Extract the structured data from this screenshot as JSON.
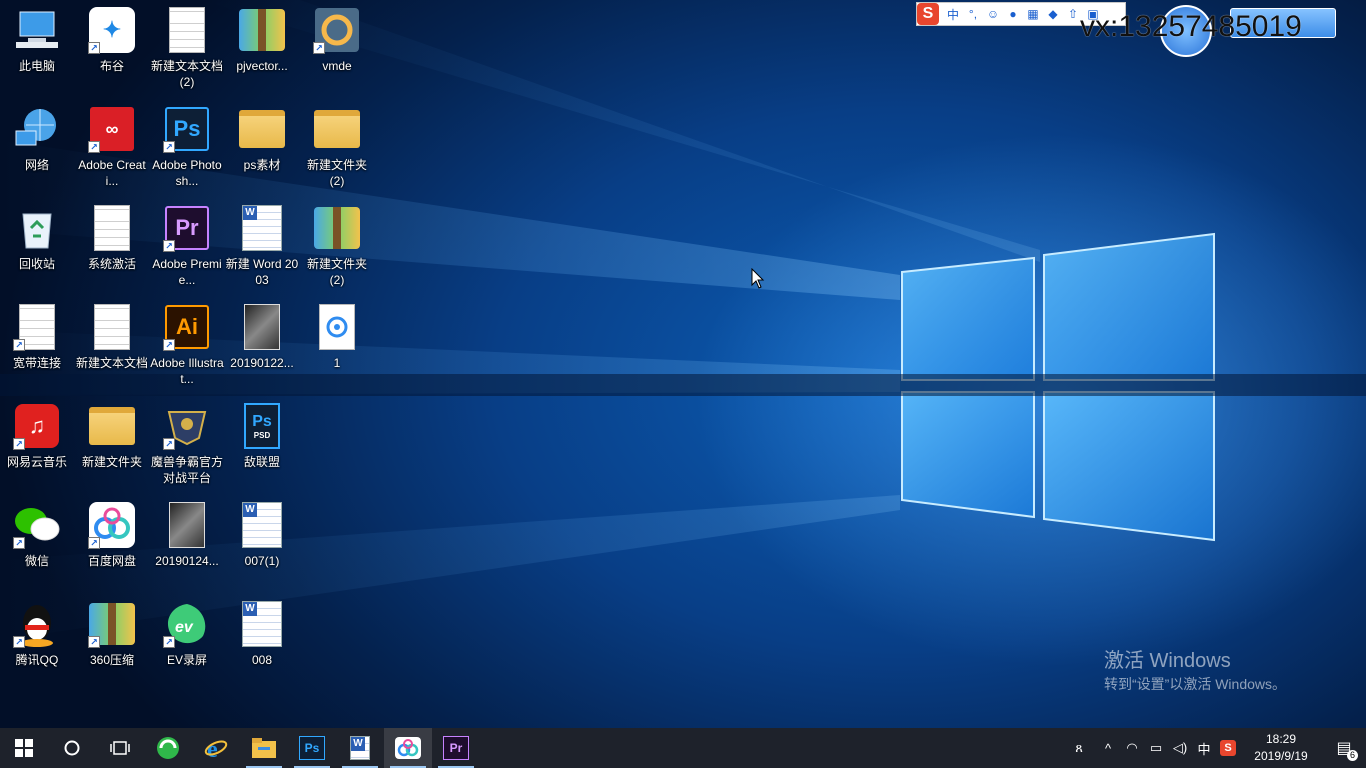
{
  "desktop": {
    "icons": [
      {
        "label": "此电脑",
        "kind": "computer-icon",
        "shortcut": false
      },
      {
        "label": "网络",
        "kind": "network-icon",
        "shortcut": false
      },
      {
        "label": "回收站",
        "kind": "recycle-bin-icon",
        "shortcut": false
      },
      {
        "label": "宽带连接",
        "kind": "file-icon",
        "shortcut": true
      },
      {
        "label": "网易云音乐",
        "kind": "netease-music-icon",
        "shortcut": true
      },
      {
        "label": "微信",
        "kind": "wechat-icon",
        "shortcut": true
      },
      {
        "label": "腾讯QQ",
        "kind": "qq-icon",
        "shortcut": true
      },
      {
        "label": "布谷",
        "kind": "bird-icon",
        "shortcut": true
      },
      {
        "label": "Adobe Creati...",
        "kind": "adobe-cc-icon",
        "shortcut": true
      },
      {
        "label": "系统激活",
        "kind": "file-icon",
        "shortcut": false
      },
      {
        "label": "新建文本文档",
        "kind": "file-icon",
        "shortcut": false
      },
      {
        "label": "新建文件夹",
        "kind": "folder-icon",
        "shortcut": false
      },
      {
        "label": "百度网盘",
        "kind": "baidu-pan-icon",
        "shortcut": true
      },
      {
        "label": "360压缩",
        "kind": "zip-icon",
        "shortcut": true
      },
      {
        "label": "新建文本文档 (2)",
        "kind": "file-icon",
        "shortcut": false
      },
      {
        "label": "Adobe Photosh...",
        "kind": "photoshop-icon",
        "shortcut": true
      },
      {
        "label": "Adobe Premie...",
        "kind": "premiere-icon",
        "shortcut": true
      },
      {
        "label": "Adobe Illustrat...",
        "kind": "illustrator-icon",
        "shortcut": true
      },
      {
        "label": "魔兽争霸官方对战平台",
        "kind": "warcraft-icon",
        "shortcut": true
      },
      {
        "label": "20190124...",
        "kind": "photo-icon",
        "shortcut": false
      },
      {
        "label": "EV录屏",
        "kind": "ev-recorder-icon",
        "shortcut": true
      },
      {
        "label": "pjvector...",
        "kind": "zip-icon",
        "shortcut": false
      },
      {
        "label": "ps素材",
        "kind": "folder-icon",
        "shortcut": false
      },
      {
        "label": "新建 Word 2003",
        "kind": "word-doc-icon",
        "shortcut": false
      },
      {
        "label": "20190122...",
        "kind": "photo-icon",
        "shortcut": false
      },
      {
        "label": "敌联盟",
        "kind": "psd-file-icon",
        "shortcut": false
      },
      {
        "label": "007(1)",
        "kind": "word-doc-icon",
        "shortcut": false
      },
      {
        "label": "008",
        "kind": "word-doc-icon",
        "shortcut": false
      },
      {
        "label": "vmde",
        "kind": "vmde-icon",
        "shortcut": true
      },
      {
        "label": "新建文件夹 (2)",
        "kind": "folder-icon",
        "shortcut": false
      },
      {
        "label": "新建文件夹 (2)",
        "kind": "zip-icon",
        "shortcut": false
      },
      {
        "label": "1",
        "kind": "media-file-icon",
        "shortcut": false
      }
    ]
  },
  "overlay": {
    "watermark": "vx:13257485019",
    "ime_lang": "中",
    "ime_punct": "°,"
  },
  "activation": {
    "title": "激活 Windows",
    "subtitle": "转到“设置”以激活 Windows。"
  },
  "taskbar": {
    "apps": [
      {
        "name": "start-button-icon",
        "open": false
      },
      {
        "name": "search-button-icon",
        "open": false
      },
      {
        "name": "task-view-icon",
        "open": false
      },
      {
        "name": "browser-360-icon",
        "open": false
      },
      {
        "name": "internet-explorer-icon",
        "open": false
      },
      {
        "name": "file-explorer-icon",
        "open": true
      },
      {
        "name": "photoshop-icon",
        "open": true
      },
      {
        "name": "word-doc-icon",
        "open": true
      },
      {
        "name": "baidu-pan-icon",
        "open": true
      },
      {
        "name": "premiere-icon",
        "open": true
      }
    ],
    "tray": {
      "ime_lang": "中",
      "time": "18:29",
      "date": "2019/9/19",
      "notification_count": "6"
    }
  },
  "colors": {
    "taskbar_bg": "#10141e",
    "wallpaper_dark": "#04214d",
    "wallpaper_light": "#5ab4ff",
    "accent_indicator": "#9cc7f2"
  }
}
